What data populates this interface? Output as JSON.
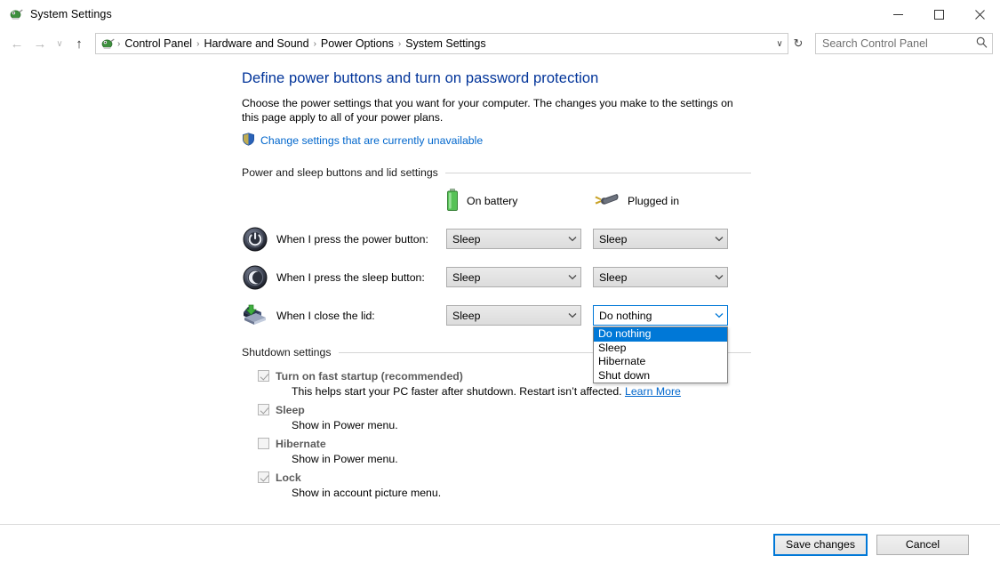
{
  "window": {
    "title": "System Settings",
    "icon": "control-panel-icon",
    "minimize": "–",
    "maximize": "□",
    "close": "✕"
  },
  "navigation": {
    "back": "←",
    "forward": "→",
    "recent": "∨",
    "up": "↑",
    "breadcrumb": [
      {
        "label": "Control Panel"
      },
      {
        "label": "Hardware and Sound"
      },
      {
        "label": "Power Options"
      },
      {
        "label": "System Settings"
      }
    ],
    "separator": "›",
    "dropdown_arrow": "∨",
    "refresh": "↻"
  },
  "search": {
    "placeholder": "Search Control Panel",
    "value": "",
    "icon": "search-icon"
  },
  "main": {
    "title": "Define power buttons and turn on password protection",
    "description": "Choose the power settings that you want for your computer. The changes you make to the settings on this page apply to all of your power plans.",
    "uac_link": "Change settings that are currently unavailable",
    "section_power": "Power and sleep buttons and lid settings",
    "columns": [
      {
        "label": "On battery",
        "icon": "battery-icon"
      },
      {
        "label": "Plugged in",
        "icon": "power-plug-icon"
      }
    ],
    "rows": [
      {
        "icon": "power-button-icon",
        "label": "When I press the power button:",
        "on_battery": "Sleep",
        "plugged_in": "Sleep",
        "open": false
      },
      {
        "icon": "sleep-button-icon",
        "label": "When I press the sleep button:",
        "on_battery": "Sleep",
        "plugged_in": "Sleep",
        "open": false
      },
      {
        "icon": "laptop-lid-icon",
        "label": "When I close the lid:",
        "on_battery": "Sleep",
        "plugged_in": "Do nothing",
        "open": true
      }
    ],
    "dropdown_options": [
      "Do nothing",
      "Sleep",
      "Hibernate",
      "Shut down"
    ],
    "dropdown_selected": "Do nothing",
    "section_shutdown": "Shutdown settings",
    "checkboxes": [
      {
        "label": "Turn on fast startup (recommended)",
        "checked": true,
        "sub": "This helps start your PC faster after shutdown. Restart isn’t affected. ",
        "sub_link": "Learn More"
      },
      {
        "label": "Sleep",
        "checked": true,
        "sub": "Show in Power menu.",
        "sub_link": ""
      },
      {
        "label": "Hibernate",
        "checked": false,
        "sub": "Show in Power menu.",
        "sub_link": ""
      },
      {
        "label": "Lock",
        "checked": true,
        "sub": "Show in account picture menu.",
        "sub_link": ""
      }
    ]
  },
  "footer": {
    "save": "Save changes",
    "cancel": "Cancel"
  },
  "colors": {
    "accent": "#0078d7",
    "title_link": "#003399",
    "link": "#0066cc"
  }
}
